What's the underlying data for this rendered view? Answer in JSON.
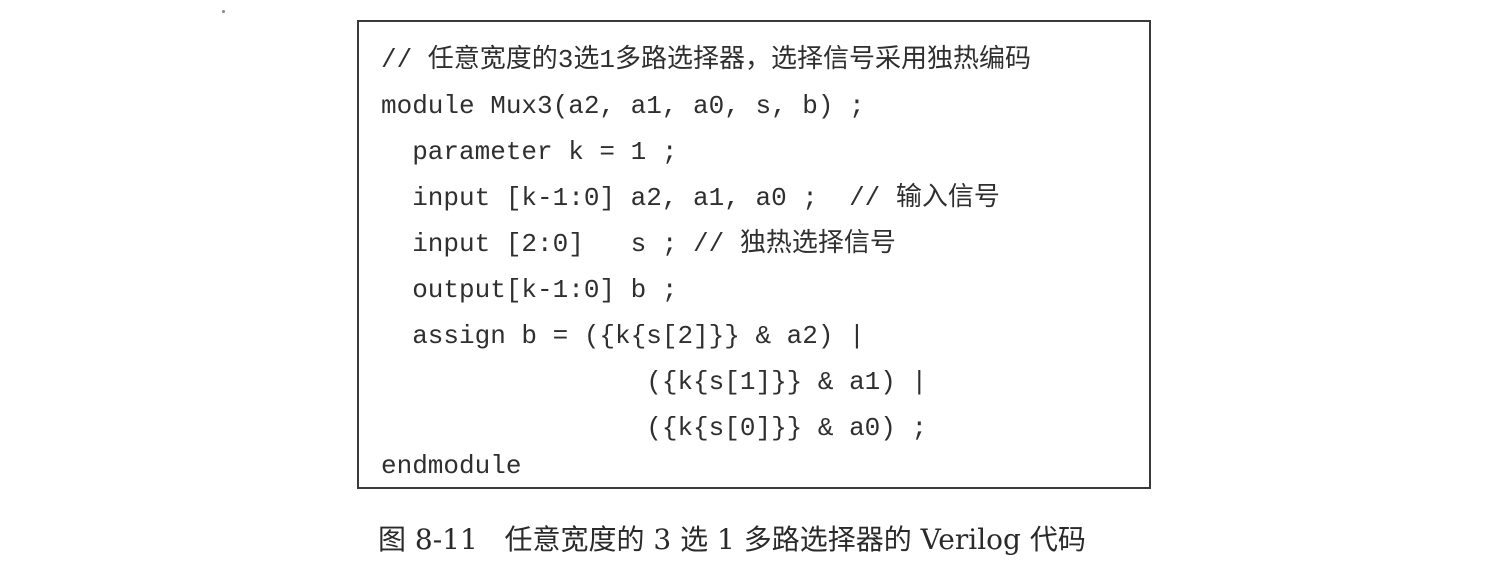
{
  "code": {
    "lines": [
      "// 任意宽度的3选1多路选择器，选择信号采用独热编码",
      "module Mux3(a2, a1, a0, s, b) ;",
      "  parameter k = 1 ;",
      "  input [k-1:0] a2, a1, a0 ;  // 输入信号",
      "  input [2:0]   s ; // 独热选择信号",
      "  output[k-1:0] b ;",
      "  assign b = ({k{s[2]}} & a2) |",
      "                 ({k{s[1]}} & a1) |",
      "                 ({k{s[0]}} & a0) ;",
      "endmodule"
    ]
  },
  "caption": "图 8-11   任意宽度的 3 选 1 多路选择器的 Verilog 代码"
}
